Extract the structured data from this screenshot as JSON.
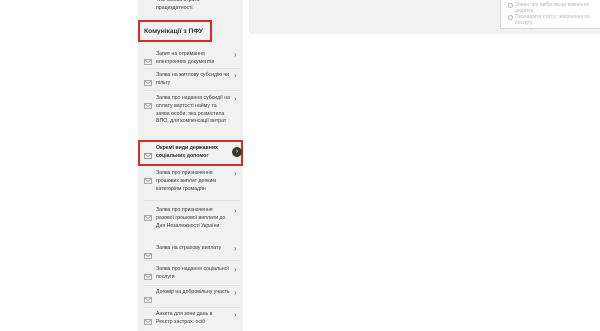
{
  "sidebar": {
    "top_item_label": "Тимчасова втрата працездатності",
    "section_title": "Комунікації з ПФУ",
    "items": [
      {
        "label": "Запит на отримання електронних документів"
      },
      {
        "label": "Заява на житлову субсидію чи пільгу"
      },
      {
        "label": "Заява про надання субсидії на оплату вартості найму та заява особи, яка розмістила ВПО, для компенсації витрат"
      },
      {
        "label": "Окремі види державних соціальних допомог",
        "active": true
      },
      {
        "label": "Заява про призначення грошових виплат деяким категоріям громадян"
      },
      {
        "label": "Заява про призначення разової грошової виплати до Дня Незалежності України"
      },
      {
        "label": "Заява на страхову виплату"
      },
      {
        "label": "Заява про надання соціальної послуги"
      },
      {
        "label": "Договір на добровільну участь"
      },
      {
        "label": "Анкета для зони дань в Реєстр застрах. осіб"
      }
    ]
  },
  "right_panel": {
    "items": [
      {
        "label": "Заява про вибір місця вивчення додатку"
      },
      {
        "label": "Перевірити статус звернення по послугу"
      }
    ]
  },
  "icons": {
    "item_icon": "envelope-icon",
    "chevron": "chevron-right-icon",
    "active_chevron": "arrow-circle-right-icon"
  },
  "colors": {
    "highlight": "#d52b2b",
    "sidebar_bg": "#f1f1f1",
    "active_arrow_bg": "#353a2a"
  }
}
